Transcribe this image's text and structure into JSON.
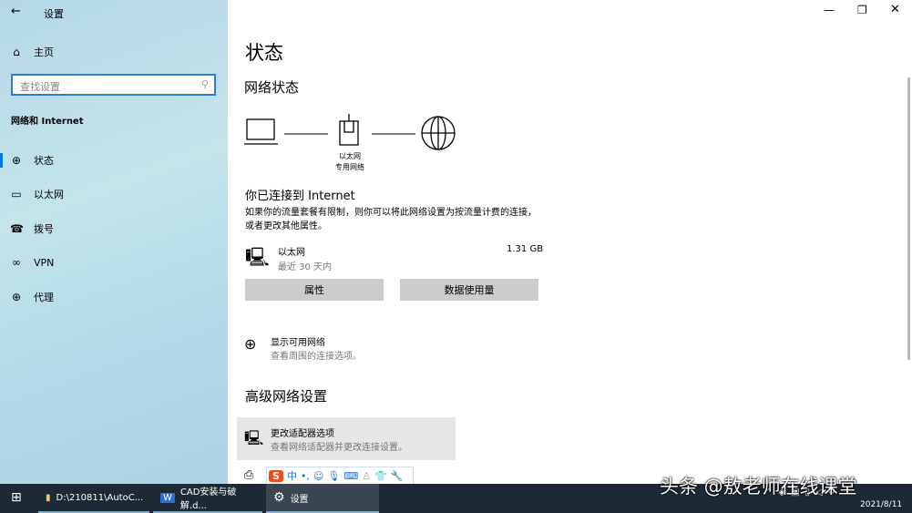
{
  "window": {
    "title": "设置",
    "back_icon": "arrow-left-icon",
    "controls": [
      "minimize",
      "maximize",
      "close"
    ]
  },
  "sidebar": {
    "home": "主页",
    "search_placeholder": "查找设置",
    "section": "网络和 Internet",
    "items": [
      {
        "label": "状态",
        "icon": "status-globe-icon",
        "selected": true
      },
      {
        "label": "以太网",
        "icon": "ethernet-icon"
      },
      {
        "label": "拨号",
        "icon": "dialup-icon"
      },
      {
        "label": "VPN",
        "icon": "vpn-icon"
      },
      {
        "label": "代理",
        "icon": "globe-icon"
      }
    ]
  },
  "main": {
    "title": "状态",
    "network_status": "网络状态",
    "diagram_label1": "以太网",
    "diagram_label2": "专用网络",
    "connected": "你已连接到 Internet",
    "description": "如果你的流量套餐有限制，则你可以将此网络设置为按流量计费的连接，或者更改其他属性。",
    "connection": {
      "name": "以太网",
      "period": "最近 30 天内",
      "usage": "1.31 GB"
    },
    "buttons": {
      "properties": "属性",
      "data_usage": "数据使用量"
    },
    "show_networks": {
      "title": "显示可用网络",
      "sub": "查看周围的连接选项。"
    },
    "advanced": "高级网络设置",
    "adapter": {
      "title": "更改适配器选项",
      "sub": "查看网络适配器并更改连接设置。"
    },
    "ime": {
      "mode": "中"
    }
  },
  "taskbar": {
    "items": [
      {
        "label": "D:\\210811\\AutoC..."
      },
      {
        "label": "CAD安装与破解.d..."
      },
      {
        "label": "设置"
      }
    ],
    "date": "2021/8/11"
  },
  "watermark": "头条 @敖老师在线课堂",
  "accent": "#0078d7"
}
